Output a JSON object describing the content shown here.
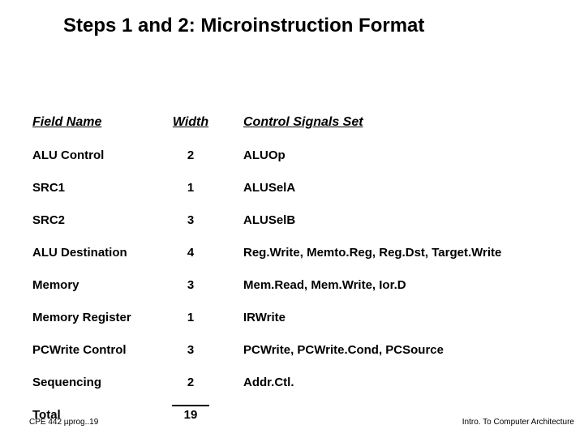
{
  "title": "Steps 1 and 2: Microinstruction Format",
  "headers": {
    "field": "Field Name",
    "width": "Width",
    "signals": "Control Signals Set"
  },
  "rows": [
    {
      "field": "ALU Control",
      "width": "2",
      "signals": "ALUOp"
    },
    {
      "field": "SRC1",
      "width": "1",
      "signals": "ALUSelA"
    },
    {
      "field": "SRC2",
      "width": "3",
      "signals": "ALUSelB"
    },
    {
      "field": "ALU Destination",
      "width": "4",
      "signals": "Reg.Write, Memto.Reg, Reg.Dst, Target.Write"
    },
    {
      "field": "Memory",
      "width": "3",
      "signals": "Mem.Read, Mem.Write, Ior.D"
    },
    {
      "field": "Memory Register",
      "width": "1",
      "signals": "IRWrite"
    },
    {
      "field": "PCWrite Control",
      "width": "3",
      "signals": "PCWrite, PCWrite.Cond, PCSource"
    },
    {
      "field": "Sequencing",
      "width": "2",
      "signals": "Addr.Ctl."
    }
  ],
  "total": {
    "label": "Total",
    "value": "19"
  },
  "footer": {
    "left": "CPE 442  µprog..19",
    "right": "Intro. To Computer Architecture"
  }
}
